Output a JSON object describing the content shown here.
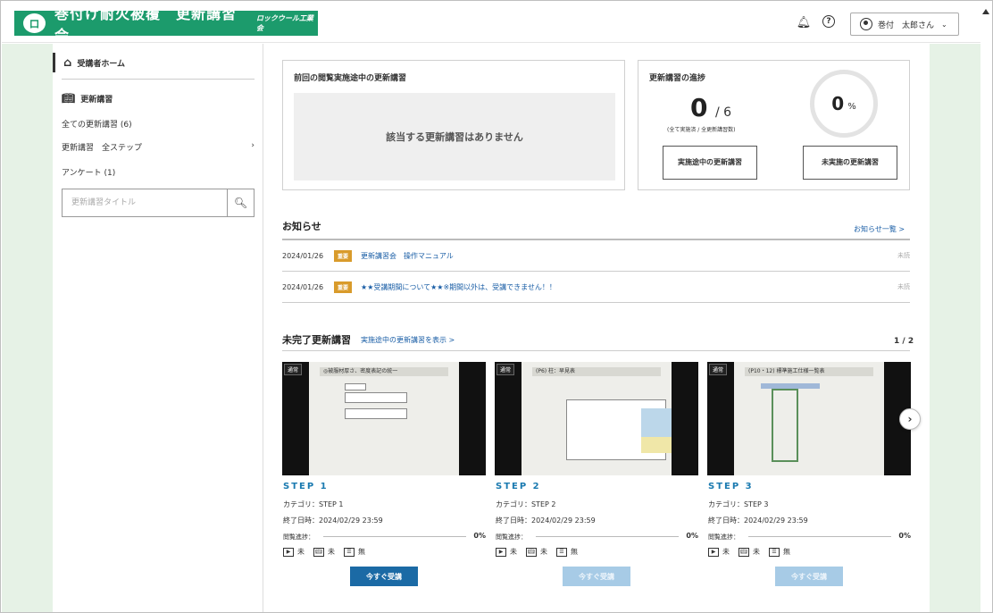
{
  "header": {
    "logo_mark": "ロ",
    "title": "巻付け耐火被覆　更新講習会",
    "subtitle": "ロックウール工業会",
    "bell_icon": "bell-icon",
    "help_icon": "help-icon",
    "user_name": "巻付　太郎さん"
  },
  "sidebar": {
    "home": "受講者ホーム",
    "section": "更新講習",
    "items": [
      {
        "label": "全ての更新講習 (6)"
      },
      {
        "label": "更新講習　全ステップ"
      },
      {
        "label": "アンケート (1)"
      }
    ],
    "search_placeholder": "更新講習タイトル"
  },
  "prev_card": {
    "title": "前回の閲覧実施途中の更新講習",
    "empty": "該当する更新講習はありません"
  },
  "progress_card": {
    "title": "更新講習の進捗",
    "done": "0",
    "total": "/ 6",
    "note": "(全て実施済 / 全更新講習数)",
    "percent": "0",
    "percent_unit": "%",
    "btn_in_progress": "実施途中の更新講習",
    "btn_not_started": "未実施の更新講習"
  },
  "news": {
    "title": "お知らせ",
    "list_link": "お知らせ一覧 >",
    "items": [
      {
        "date": "2024/01/26",
        "badge": "重要",
        "title": "更新講習会　操作マニュアル",
        "status": "未読"
      },
      {
        "date": "2024/01/26",
        "badge": "重要",
        "title": "★★受講期間について★★※期間以外は、受講できません！！",
        "status": "未読"
      }
    ]
  },
  "incomplete": {
    "title": "未完了更新講習",
    "link": "実施途中の更新講習を表示 >",
    "page": "1 / 2",
    "courses": [
      {
        "tag": "通常",
        "thumb": "◎被服材厚さ、密度表記の統一",
        "step": "STEP 1",
        "category": "カテゴリ：STEP 1",
        "deadline": "終了日時：2024/02/29 23:59",
        "progress_label": "閲覧進捗：",
        "progress": "0%",
        "video": "未",
        "text": "未",
        "test": "無",
        "button": "今すぐ受講",
        "enabled": true
      },
      {
        "tag": "通常",
        "thumb": "(P6) 柱：早見表",
        "step": "STEP 2",
        "category": "カテゴリ：STEP 2",
        "deadline": "終了日時：2024/02/29 23:59",
        "progress_label": "閲覧進捗：",
        "progress": "0%",
        "video": "未",
        "text": "未",
        "test": "無",
        "button": "今すぐ受講",
        "enabled": false
      },
      {
        "tag": "通常",
        "thumb": "(P10・12) 標準施工仕様一覧表",
        "step": "STEP 3",
        "category": "カテゴリ：STEP 3",
        "deadline": "終了日時：2024/02/29 23:59",
        "progress_label": "閲覧進捗：",
        "progress": "0%",
        "video": "未",
        "text": "未",
        "test": "無",
        "button": "今すぐ受講",
        "enabled": false
      }
    ]
  },
  "colors": {
    "brand_green": "#1c9b6c",
    "link_blue": "#1a5ea6",
    "button_blue": "#1b6aa5",
    "badge_orange": "#d99b2b",
    "side_green": "#e6f2e6"
  }
}
